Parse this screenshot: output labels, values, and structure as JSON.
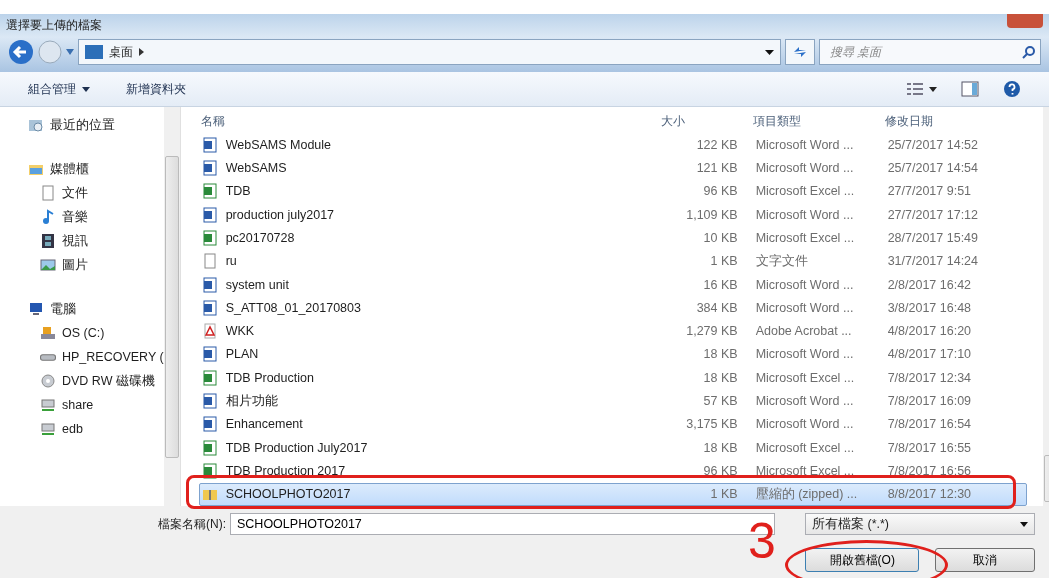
{
  "window": {
    "title": "選擇要上傳的檔案"
  },
  "address_bar": {
    "location": "桌面",
    "search_placeholder": "搜尋 桌面"
  },
  "toolbar": {
    "organize": "組合管理",
    "new_folder": "新增資料夾"
  },
  "sidebar": {
    "items": [
      {
        "label": "最近的位置",
        "kind": "recent"
      },
      {
        "label": "媒體櫃",
        "kind": "library",
        "children": [
          {
            "label": "文件",
            "kind": "documents"
          },
          {
            "label": "音樂",
            "kind": "music"
          },
          {
            "label": "視訊",
            "kind": "video"
          },
          {
            "label": "圖片",
            "kind": "pictures"
          }
        ]
      },
      {
        "label": "電腦",
        "kind": "computer",
        "children": [
          {
            "label": "OS (C:)",
            "kind": "os-drive"
          },
          {
            "label": "HP_RECOVERY (",
            "kind": "drive"
          },
          {
            "label": "DVD RW 磁碟機",
            "kind": "dvd"
          },
          {
            "label": "share",
            "kind": "network"
          },
          {
            "label": "edb",
            "kind": "network"
          }
        ]
      }
    ]
  },
  "table": {
    "columns": [
      "名稱",
      "大小",
      "項目類型",
      "修改日期"
    ],
    "rows": [
      {
        "name": "WebSAMS Module",
        "size": "122 KB",
        "type": "Microsoft Word ...",
        "date": "25/7/2017 14:52",
        "kind": "word",
        "selected": false
      },
      {
        "name": "WebSAMS",
        "size": "121 KB",
        "type": "Microsoft Word ...",
        "date": "25/7/2017 14:54",
        "kind": "word",
        "selected": false
      },
      {
        "name": "TDB",
        "size": "96 KB",
        "type": "Microsoft Excel ...",
        "date": "27/7/2017 9:51",
        "kind": "excel",
        "selected": false
      },
      {
        "name": "production july2017",
        "size": "1,109 KB",
        "type": "Microsoft Word ...",
        "date": "27/7/2017 17:12",
        "kind": "word",
        "selected": false
      },
      {
        "name": "pc20170728",
        "size": "10 KB",
        "type": "Microsoft Excel ...",
        "date": "28/7/2017 15:49",
        "kind": "excel",
        "selected": false
      },
      {
        "name": "ru",
        "size": "1 KB",
        "type": "文字文件",
        "date": "31/7/2017 14:24",
        "kind": "text",
        "selected": false
      },
      {
        "name": "system unit",
        "size": "16 KB",
        "type": "Microsoft Word ...",
        "date": "2/8/2017 16:42",
        "kind": "word",
        "selected": false
      },
      {
        "name": "S_ATT08_01_20170803",
        "size": "384 KB",
        "type": "Microsoft Word ...",
        "date": "3/8/2017 16:48",
        "kind": "word",
        "selected": false
      },
      {
        "name": "WKK",
        "size": "1,279 KB",
        "type": "Adobe Acrobat ...",
        "date": "4/8/2017 16:20",
        "kind": "pdf",
        "selected": false
      },
      {
        "name": "PLAN",
        "size": "18 KB",
        "type": "Microsoft Word ...",
        "date": "4/8/2017 17:10",
        "kind": "word",
        "selected": false
      },
      {
        "name": "TDB Production",
        "size": "18 KB",
        "type": "Microsoft Excel ...",
        "date": "7/8/2017 12:34",
        "kind": "excel",
        "selected": false
      },
      {
        "name": "相片功能",
        "size": "57 KB",
        "type": "Microsoft Word ...",
        "date": "7/8/2017 16:09",
        "kind": "word",
        "selected": false
      },
      {
        "name": "Enhancement",
        "size": "3,175 KB",
        "type": "Microsoft Word ...",
        "date": "7/8/2017 16:54",
        "kind": "word",
        "selected": false
      },
      {
        "name": "TDB Production July2017",
        "size": "18 KB",
        "type": "Microsoft Excel ...",
        "date": "7/8/2017 16:55",
        "kind": "excel",
        "selected": false
      },
      {
        "name": "TDB Production 2017",
        "size": "96 KB",
        "type": "Microsoft Excel ...",
        "date": "7/8/2017 16:56",
        "kind": "excel",
        "selected": false
      },
      {
        "name": "SCHOOLPHOTO2017",
        "size": "1 KB",
        "type": "壓縮的 (zipped) ...",
        "date": "8/8/2017 12:30",
        "kind": "zip",
        "selected": true
      }
    ]
  },
  "footer": {
    "filename_label": "檔案名稱(N):",
    "filename": "SCHOOLPHOTO2017",
    "filter": "所有檔案 (*.*)",
    "open_button": "開啟舊檔(O)",
    "cancel_button": "取消"
  },
  "annotation": {
    "step": "3"
  }
}
